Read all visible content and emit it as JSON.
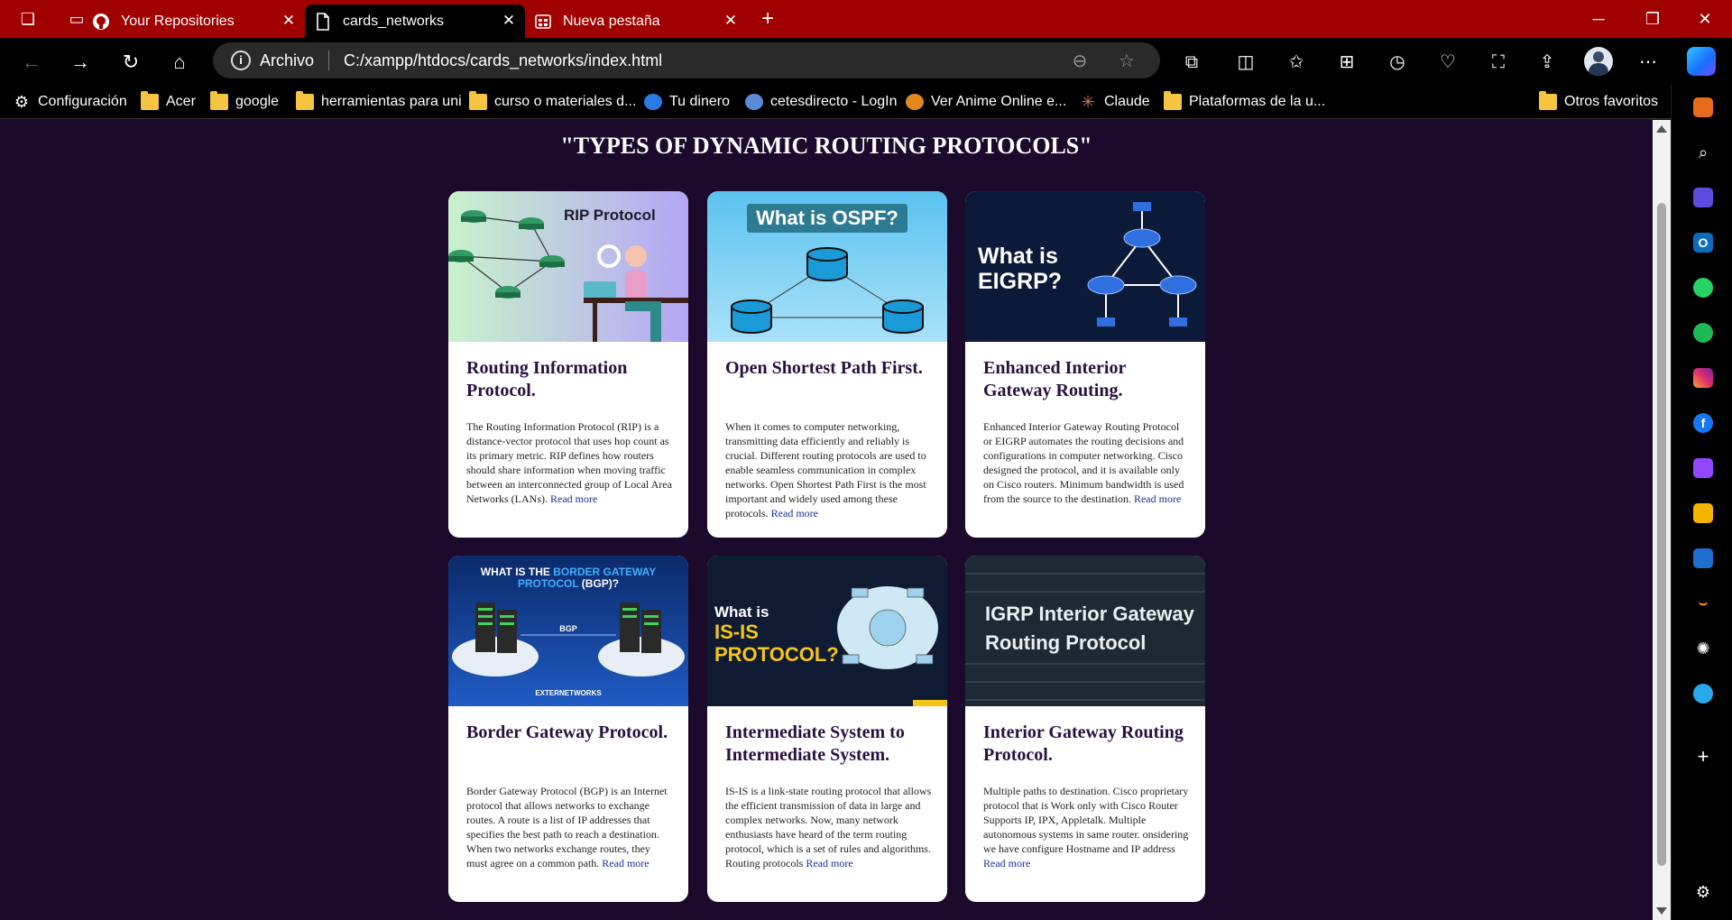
{
  "browser": {
    "tabs": [
      {
        "label": "Your Repositories",
        "active": false
      },
      {
        "label": "cards_networks",
        "active": true
      },
      {
        "label": "Nueva pestaña",
        "active": false
      }
    ],
    "address": {
      "label": "Archivo",
      "url": "C:/xampp/htdocs/cards_networks/index.html"
    },
    "bookmarks": [
      {
        "label": "Configuración",
        "icon": "gear-icon"
      },
      {
        "label": "Acer",
        "icon": "folder-icon"
      },
      {
        "label": "google",
        "icon": "folder-icon"
      },
      {
        "label": "herramientas para uni",
        "icon": "folder-icon"
      },
      {
        "label": "curso o materiales d...",
        "icon": "folder-icon"
      },
      {
        "label": "Tu dinero",
        "icon": "tu-dinero-icon"
      },
      {
        "label": "cetesdirecto - LogIn",
        "icon": "cetes-icon"
      },
      {
        "label": "Ver Anime Online e...",
        "icon": "anime-icon"
      },
      {
        "label": "Claude",
        "icon": "claude-icon"
      },
      {
        "label": "Plataformas de la u...",
        "icon": "folder-icon"
      },
      {
        "label": "Otros favoritos",
        "icon": "folder-icon"
      }
    ],
    "colors": {
      "titlebar": "#a10000",
      "page_bg": "#1c0a2c",
      "card_title": "#2a1040",
      "link": "#1a2f9e"
    }
  },
  "page": {
    "title": "\"TYPES OF DYNAMIC ROUTING PROTOCOLS\"",
    "read_more": "Read more",
    "cards": [
      {
        "title": "Routing Information Protocol.",
        "text": "The Routing Information Protocol (RIP) is a distance-vector protocol that uses hop count as its primary metric. RIP defines how routers should share information when moving traffic between an interconnected group of Local Area Networks (LANs).",
        "image_caption": "RIP Protocol"
      },
      {
        "title": "Open Shortest Path First.",
        "text": "When it comes to computer networking, transmitting data efficiently and reliably is crucial. Different routing protocols are used to enable seamless communication in complex networks. Open Shortest Path First is the most important and widely used among these protocols.",
        "image_caption": "What is OSPF?"
      },
      {
        "title": "Enhanced Interior Gateway Routing.",
        "text": "Enhanced Interior Gateway Routing Protocol or EIGRP automates the routing decisions and configurations in computer networking. Cisco designed the protocol, and it is available only on Cisco routers. Minimum bandwidth is used from the source to the destination.",
        "image_caption": "What is EIGRP?"
      },
      {
        "title": "Border Gateway Protocol.",
        "text": "Border Gateway Protocol (BGP) is an Internet protocol that allows networks to exchange routes. A route is a list of IP addresses that specifies the best path to reach a destination. When two networks exchange routes, they must agree on a common path.",
        "image_caption": "WHAT IS THE BORDER GATEWAY PROTOCOL (BGP)?"
      },
      {
        "title": "Intermediate System to Intermediate System.",
        "text": "IS-IS is a link-state routing protocol that allows the efficient transmission of data in large and complex networks. Now, many network enthusiasts have heard of the term routing protocol, which is a set of rules and algorithms. Routing protocols",
        "image_caption": "What is IS-IS PROTOCOL?"
      },
      {
        "title": "Interior Gateway Routing Protocol.",
        "text": "Multiple paths to destination. Cisco proprietary protocol that is Work only with Cisco Router Supports IP, IPX, Appletalk. Multiple autonomous systems in same router. onsidering we have configure Hostname and IP address",
        "image_caption": "IGRP Interior Gateway Routing Protocol"
      }
    ]
  }
}
